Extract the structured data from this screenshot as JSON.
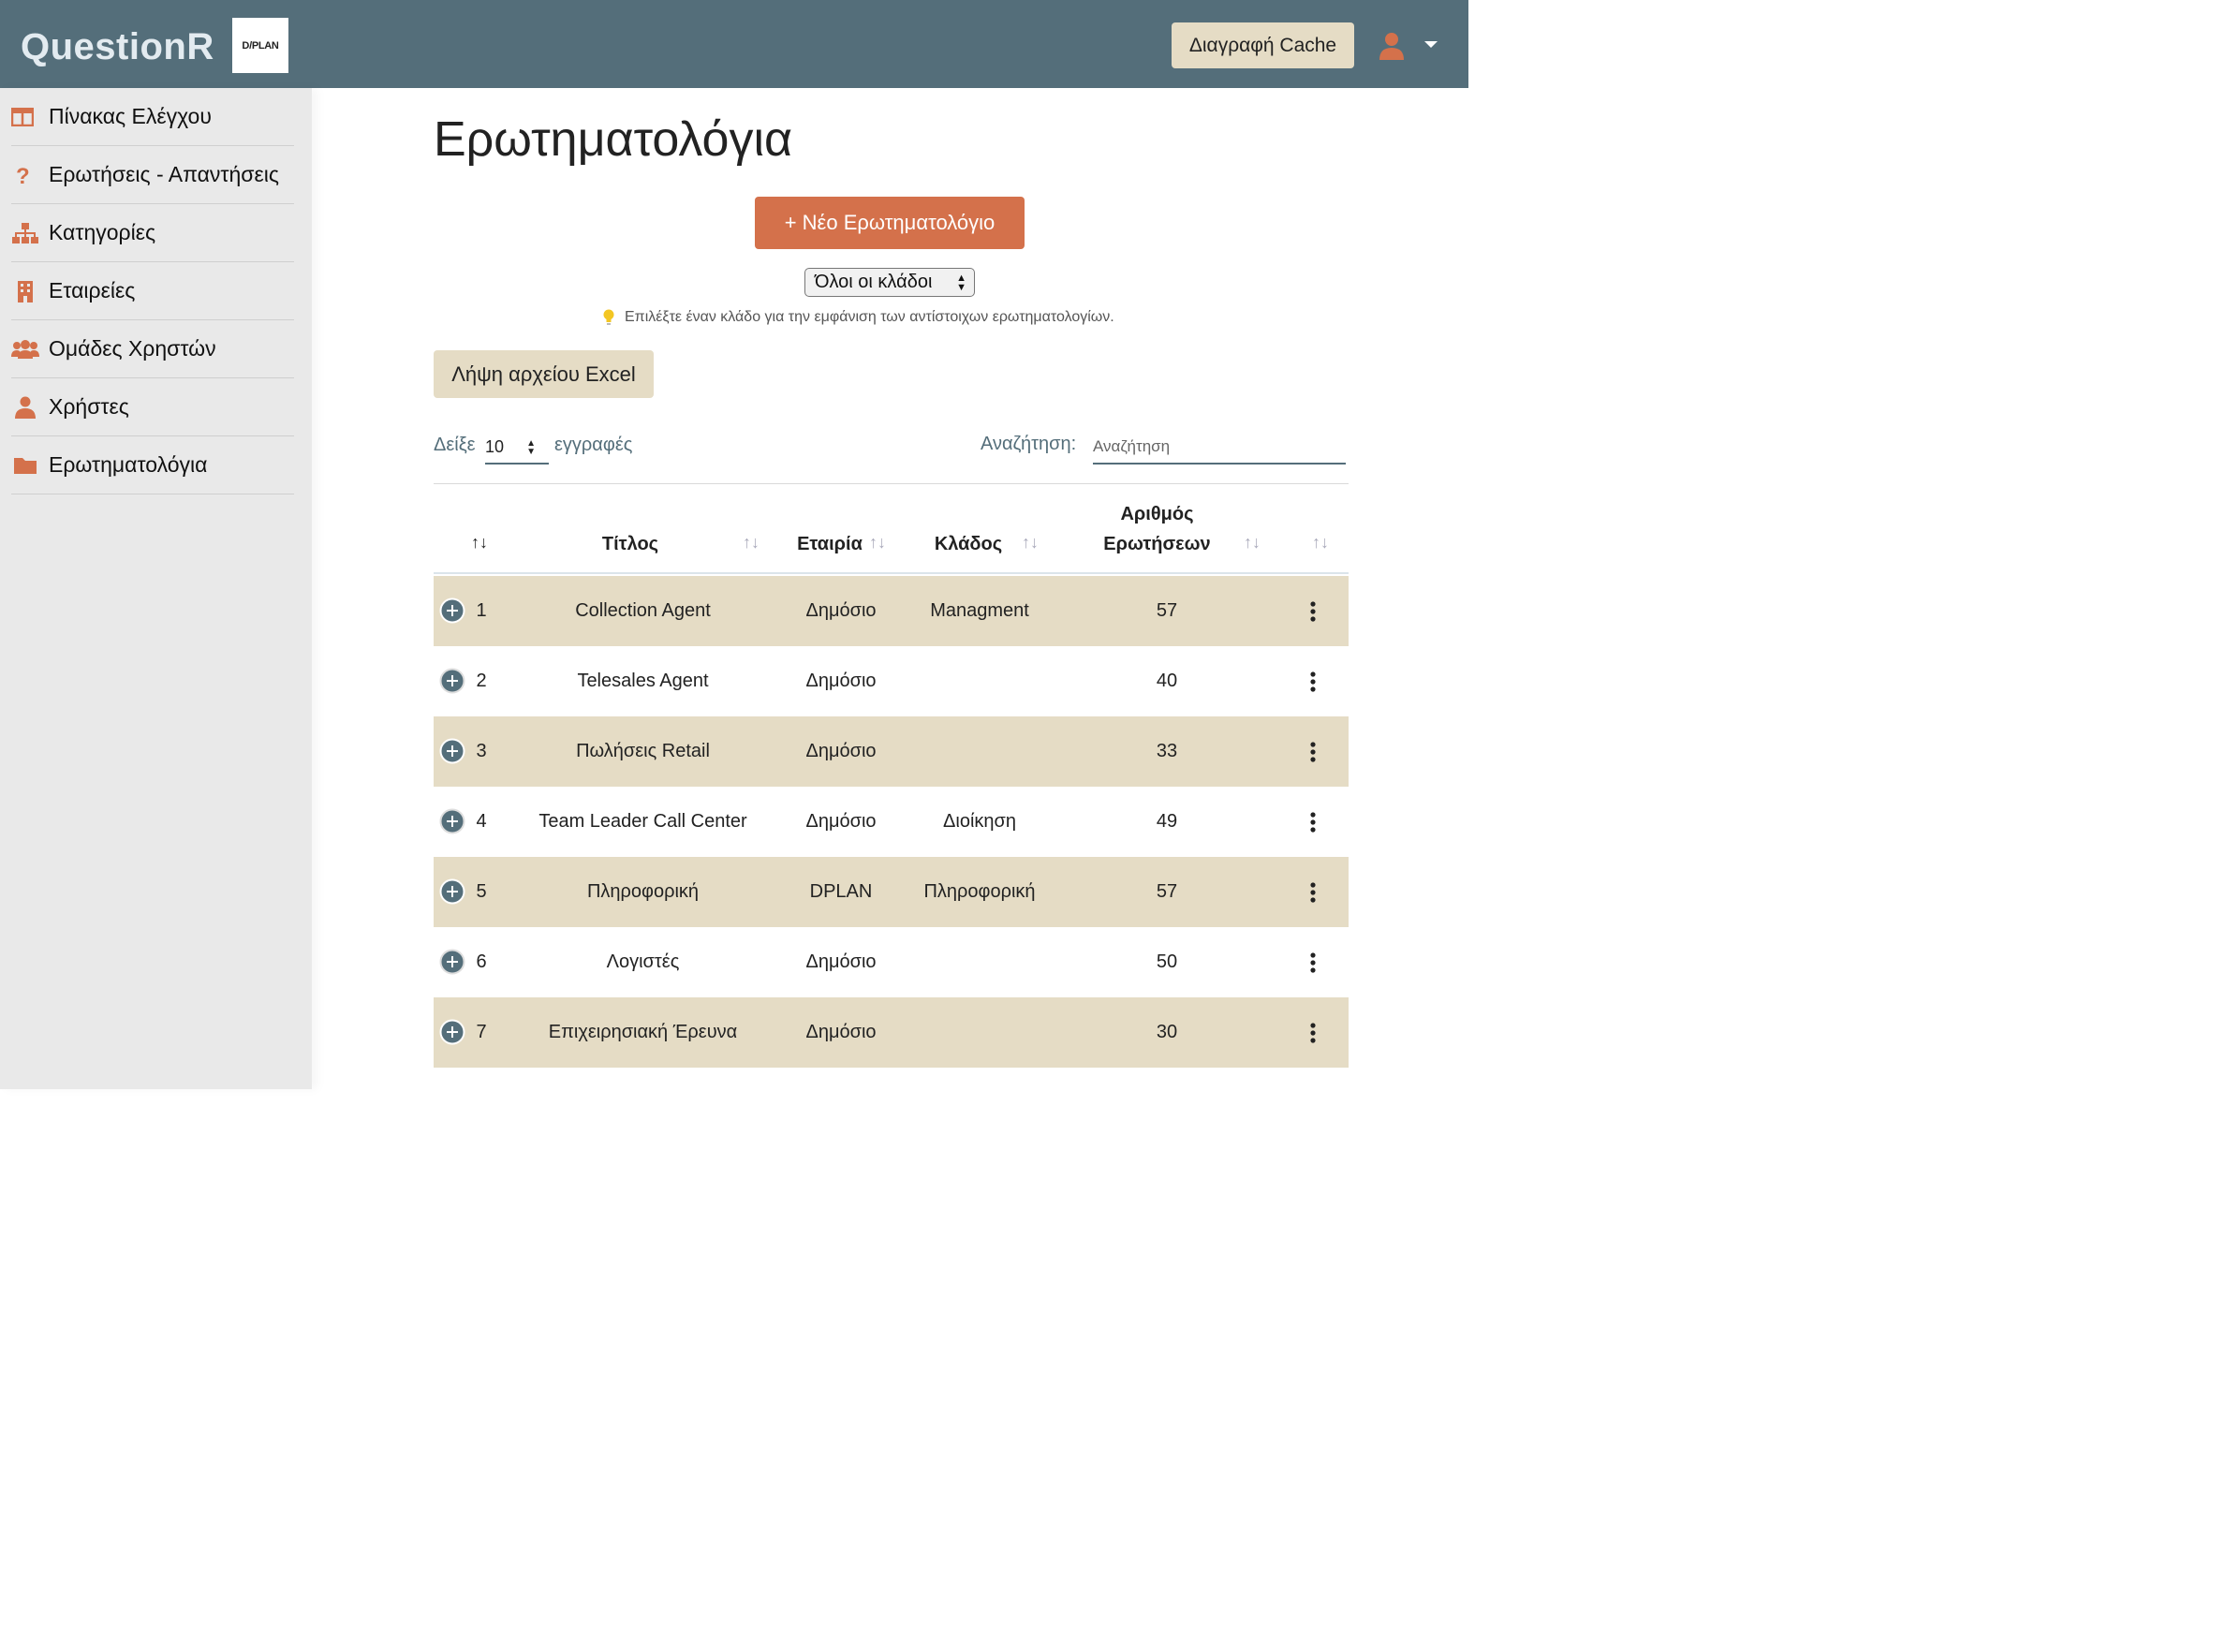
{
  "header": {
    "brand": "QuestionR",
    "logo_text": "D/PLAN",
    "cache_button": "Διαγραφή Cache",
    "accent_color": "#d4714b",
    "header_color": "#546e7a"
  },
  "sidebar": {
    "items": [
      {
        "label": "Πίνακας Ελέγχου",
        "icon": "table-icon"
      },
      {
        "label": "Ερωτήσεις - Απαντήσεις",
        "icon": "question-icon"
      },
      {
        "label": "Κατηγορίες",
        "icon": "sitemap-icon"
      },
      {
        "label": "Εταιρείες",
        "icon": "building-icon"
      },
      {
        "label": "Ομάδες Χρηστών",
        "icon": "users-icon"
      },
      {
        "label": "Χρήστες",
        "icon": "user-icon"
      },
      {
        "label": "Ερωτηματολόγια",
        "icon": "folder-icon"
      }
    ]
  },
  "main": {
    "title": "Ερωτηματολόγια",
    "new_button": "+ Νέο Ερωτηματολόγιο",
    "branch_filter": "Όλοι οι κλάδοι",
    "hint": "Επιλέξτε έναν κλάδο για την εμφάνιση των αντίστοιχων ερωτηματολογίων.",
    "excel_button": "Λήψη αρχείου Excel",
    "length": {
      "prefix": "Δείξε",
      "value": "10",
      "suffix": "εγγραφές"
    },
    "search": {
      "label": "Αναζήτηση:",
      "placeholder": "Αναζήτηση"
    }
  },
  "table": {
    "headers": {
      "title": "Τίτλος",
      "company": "Εταιρία",
      "branch": "Κλάδος",
      "count_line1": "Αριθμός",
      "count_line2": "Ερωτήσεων"
    },
    "rows": [
      {
        "id": "1",
        "title": "Collection Agent",
        "company": "Δημόσιο",
        "branch": "Managment",
        "count": "57"
      },
      {
        "id": "2",
        "title": "Telesales Agent",
        "company": "Δημόσιο",
        "branch": "",
        "count": "40"
      },
      {
        "id": "3",
        "title": "Πωλήσεις Retail",
        "company": "Δημόσιο",
        "branch": "",
        "count": "33"
      },
      {
        "id": "4",
        "title": "Team Leader Call Center",
        "company": "Δημόσιο",
        "branch": "Διοίκηση",
        "count": "49"
      },
      {
        "id": "5",
        "title": "Πληροφορική",
        "company": "DPLAN",
        "branch": "Πληροφορική",
        "count": "57"
      },
      {
        "id": "6",
        "title": "Λογιστές",
        "company": "Δημόσιο",
        "branch": "",
        "count": "50"
      },
      {
        "id": "7",
        "title": "Επιχειρησιακή Έρευνα",
        "company": "Δημόσιο",
        "branch": "",
        "count": "30"
      }
    ]
  }
}
